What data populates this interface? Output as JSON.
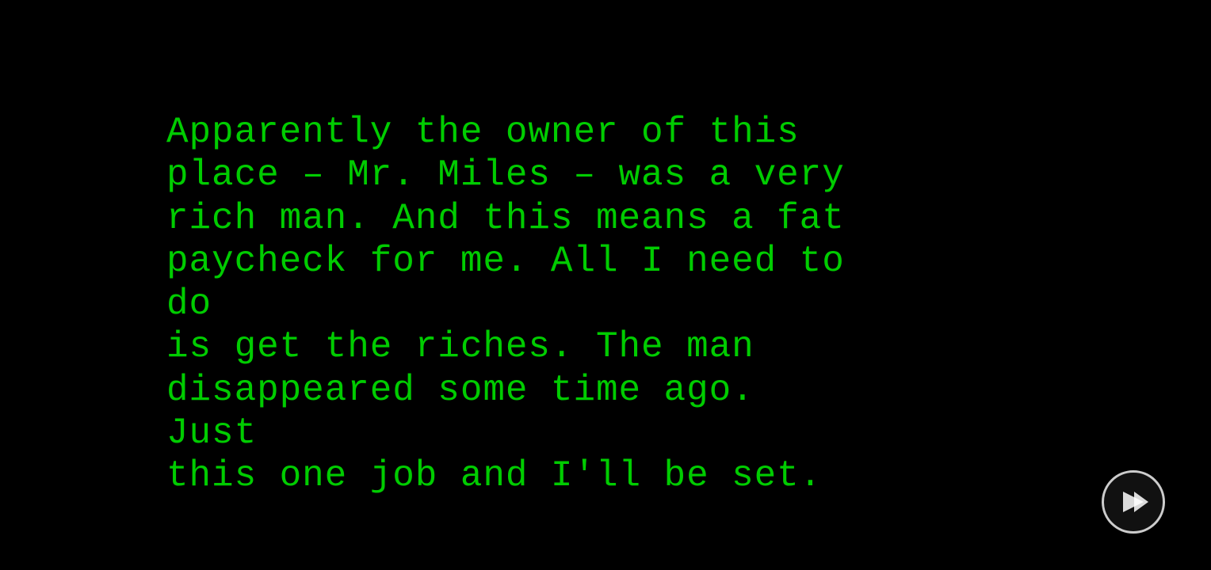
{
  "screen": {
    "background": "#000000"
  },
  "text_block": {
    "content": "Apparently the owner of this\nplace – Mr. Miles – was a very\nrich man. And this means a fat\npaycheck for me. All I need to do\nis get the riches. The man\ndisappeared some time ago. Just\nthis one job and I'll be set."
  },
  "next_button": {
    "label": "next",
    "aria_label": "Next"
  }
}
